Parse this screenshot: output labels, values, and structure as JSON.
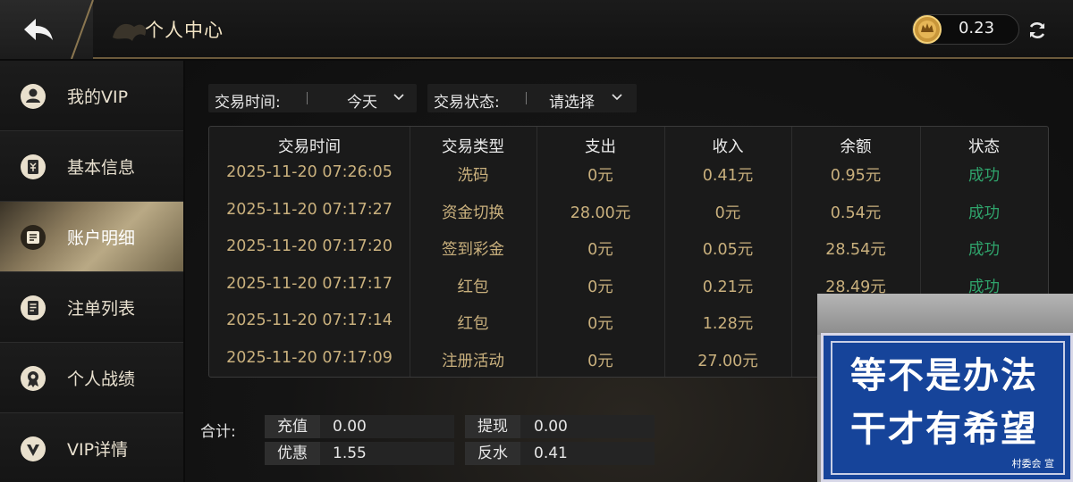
{
  "header": {
    "title": "个人中心",
    "balance": "0.23"
  },
  "sidebar": {
    "items": [
      {
        "label": "我的VIP",
        "icon": "user-icon"
      },
      {
        "label": "基本信息",
        "icon": "info-card-icon"
      },
      {
        "label": "账户明细",
        "icon": "ledger-icon",
        "active": true
      },
      {
        "label": "注单列表",
        "icon": "bet-list-icon"
      },
      {
        "label": "个人战绩",
        "icon": "medal-icon"
      },
      {
        "label": "VIP详情",
        "icon": "vip-badge-icon"
      }
    ]
  },
  "filters": {
    "time_label": "交易时间:",
    "time_value": "今天",
    "status_label": "交易状态:",
    "status_value": "请选择"
  },
  "table": {
    "headers": [
      "交易时间",
      "交易类型",
      "支出",
      "收入",
      "余额",
      "状态"
    ],
    "rows": [
      [
        "2025-11-20 07:26:05",
        "洗码",
        "0元",
        "0.41元",
        "0.95元",
        "成功"
      ],
      [
        "2025-11-20 07:17:27",
        "资金切换",
        "28.00元",
        "0元",
        "0.54元",
        "成功"
      ],
      [
        "2025-11-20 07:17:20",
        "签到彩金",
        "0元",
        "0.05元",
        "28.54元",
        "成功"
      ],
      [
        "2025-11-20 07:17:17",
        "红包",
        "0元",
        "0.21元",
        "28.49元",
        "成功"
      ],
      [
        "2025-11-20 07:17:14",
        "红包",
        "0元",
        "1.28元",
        "",
        ""
      ],
      [
        "2025-11-20 07:17:09",
        "注册活动",
        "0元",
        "27.00元",
        "",
        ""
      ]
    ]
  },
  "summary": {
    "label": "合计:",
    "recharge_label": "充值",
    "recharge_value": "0.00",
    "withdraw_label": "提现",
    "withdraw_value": "0.00",
    "discount_label": "优惠",
    "discount_value": "1.55",
    "rebate_label": "反水",
    "rebate_value": "0.41"
  },
  "overlay_sign": {
    "line1": "等不是办法",
    "line2": "干才有希望",
    "footer": "村委会 宣"
  },
  "colors": {
    "gold_text": "#c9b07d",
    "success": "#2fa36b",
    "accent_border": "#6b5a3b",
    "sign_blue": "#16449a"
  }
}
